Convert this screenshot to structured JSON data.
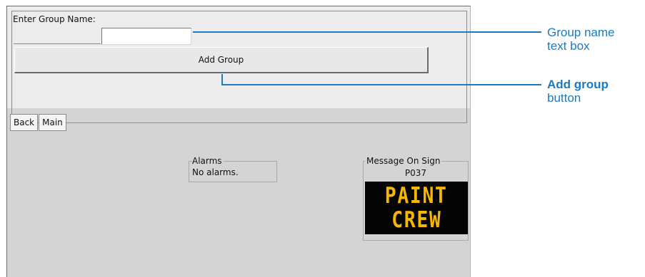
{
  "group_panel": {
    "label": "Enter Group Name:",
    "name_value": "",
    "add_button": "Add Group"
  },
  "nav": {
    "back": "Back",
    "main": "Main"
  },
  "alarms": {
    "title": "Alarms",
    "text": "No alarms."
  },
  "sign": {
    "title": "Message On Sign",
    "code": "P037",
    "line1": "PAINT",
    "line2": "CREW"
  },
  "callouts": {
    "textbox_line1": "Group name",
    "textbox_line2": "text box",
    "button_bold": "Add group",
    "button_rest": "button"
  },
  "colors": {
    "callout": "#1a7bbf",
    "sign_text": "#f5b800",
    "sign_bg": "#050505"
  }
}
